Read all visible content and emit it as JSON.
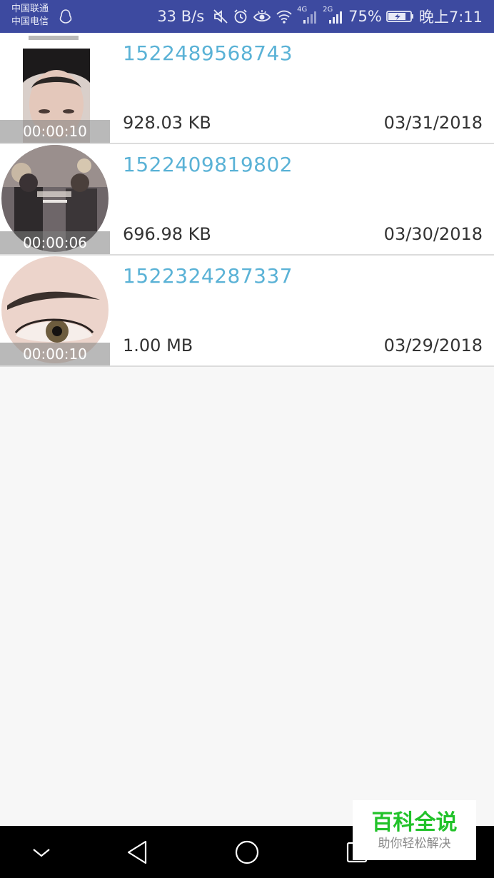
{
  "status_bar": {
    "carrier_1": "中国联通",
    "carrier_2": "中国电信",
    "net_speed": "33 B/s",
    "network_4g": "4G",
    "network_2g": "2G",
    "battery": "75%",
    "time": "晚上7:11",
    "background_color": "#3d4aa0"
  },
  "videos": [
    {
      "title": "1522489568743",
      "duration": "00:00:10",
      "size": "928.03 KB",
      "date": "03/31/2018"
    },
    {
      "title": "1522409819802",
      "duration": "00:00:06",
      "size": "696.98 KB",
      "date": "03/30/2018"
    },
    {
      "title": "1522324287337",
      "duration": "00:00:10",
      "size": "1.00 MB",
      "date": "03/29/2018"
    }
  ],
  "watermark": {
    "title": "百科全说",
    "subtitle": "助你轻松解决"
  },
  "nav_bar": {
    "icons": [
      "chevron-down-icon",
      "back-icon",
      "home-icon",
      "recents-icon"
    ]
  },
  "colors": {
    "title_accent": "#5ab2d6",
    "watermark_green": "#22c22a"
  }
}
